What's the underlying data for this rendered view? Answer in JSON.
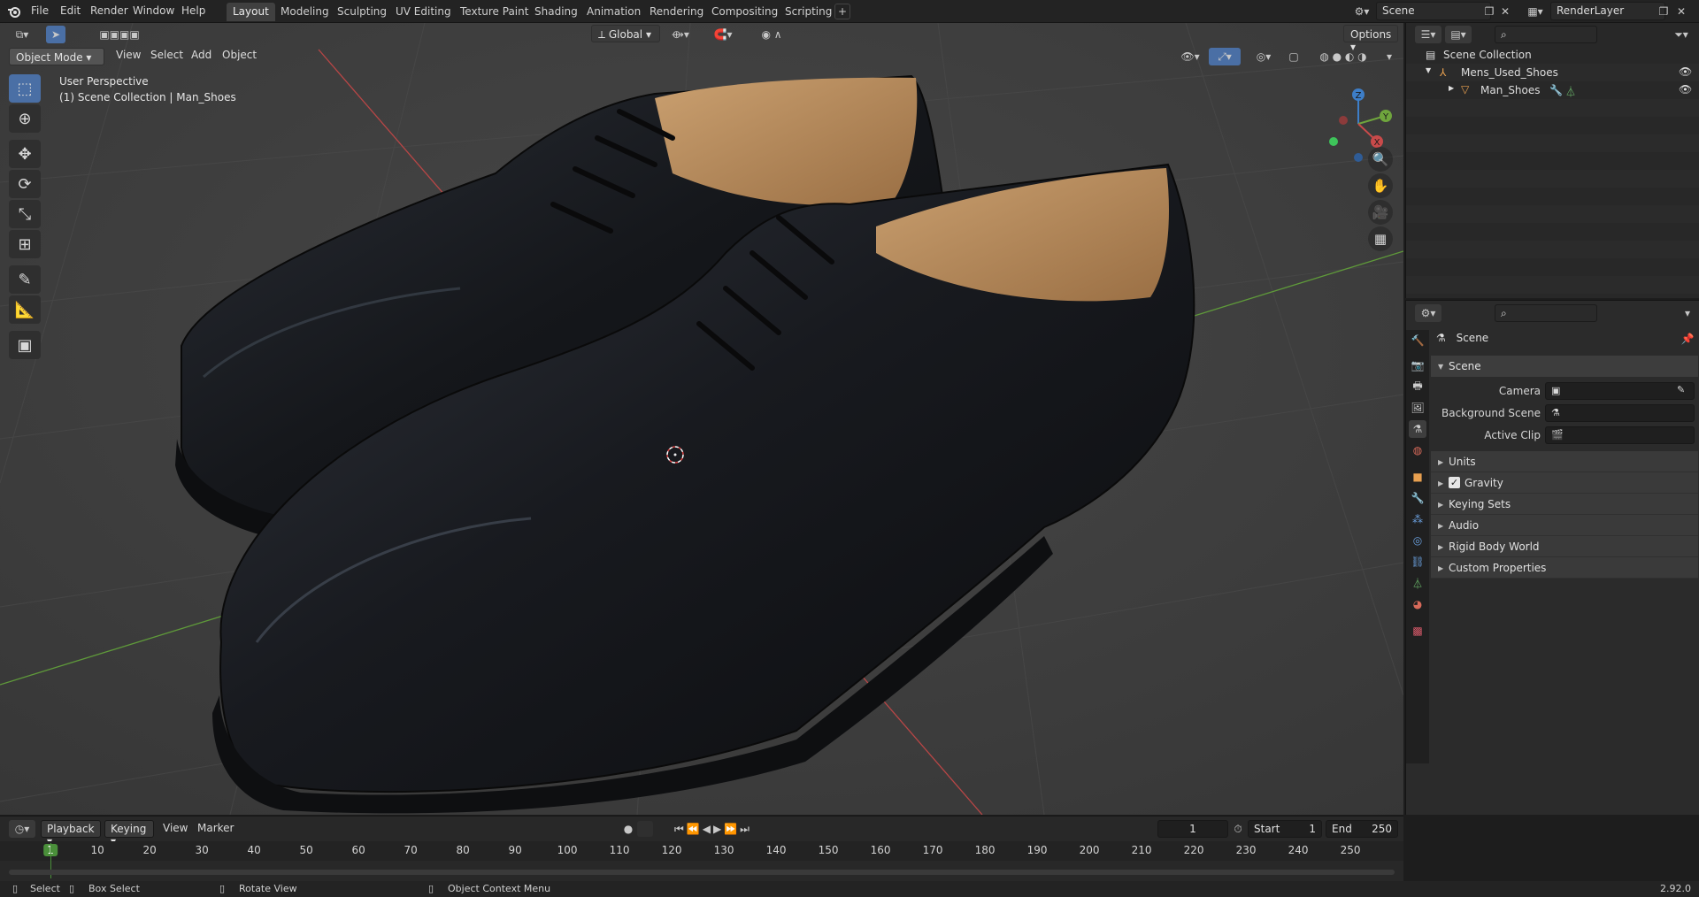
{
  "menus": {
    "file": "File",
    "edit": "Edit",
    "render": "Render",
    "window": "Window",
    "help": "Help"
  },
  "workspaces": [
    "Layout",
    "Modeling",
    "Sculpting",
    "UV Editing",
    "Texture Paint",
    "Shading",
    "Animation",
    "Rendering",
    "Compositing",
    "Scripting"
  ],
  "scene_selector": "Scene",
  "view_layer": "RenderLayer",
  "viewport": {
    "mode": "Object Mode",
    "menu_view": "View",
    "menu_select": "Select",
    "menu_add": "Add",
    "menu_object": "Object",
    "orientation": "Global",
    "options": "Options",
    "perspective": "User Perspective",
    "collection_info": "(1) Scene Collection | Man_Shoes",
    "gizmo": {
      "x": "X",
      "y": "Y",
      "z": "Z"
    }
  },
  "outliner": {
    "root": "Scene Collection",
    "collection": "Mens_Used_Shoes",
    "object": "Man_Shoes"
  },
  "properties": {
    "context": "Scene",
    "panel_title": "Scene",
    "camera_label": "Camera",
    "background_label": "Background Scene",
    "clip_label": "Active Clip",
    "subpanels": [
      "Units",
      "Gravity",
      "Keying Sets",
      "Audio",
      "Rigid Body World",
      "Custom Properties"
    ],
    "gravity_enabled": true
  },
  "timeline": {
    "playback": "Playback",
    "keying": "Keying",
    "view": "View",
    "marker": "Marker",
    "current_frame": "1",
    "start_label": "Start",
    "start": "1",
    "end_label": "End",
    "end": "250",
    "ticks": [
      "1",
      "10",
      "20",
      "30",
      "40",
      "50",
      "60",
      "70",
      "80",
      "90",
      "100",
      "110",
      "120",
      "130",
      "140",
      "150",
      "160",
      "170",
      "180",
      "190",
      "200",
      "210",
      "220",
      "230",
      "240",
      "250"
    ]
  },
  "status": {
    "select": "Select",
    "box_select": "Box Select",
    "rotate_view": "Rotate View",
    "context_menu": "Object Context Menu",
    "version": "2.92.0"
  },
  "colors": {
    "accent": "#4a6fa5",
    "x_axis": "#c84a4a",
    "y_axis": "#6fa53d",
    "z_axis": "#3d7ec8",
    "leather": "#1c1e22",
    "lining": "#b98a5a"
  }
}
